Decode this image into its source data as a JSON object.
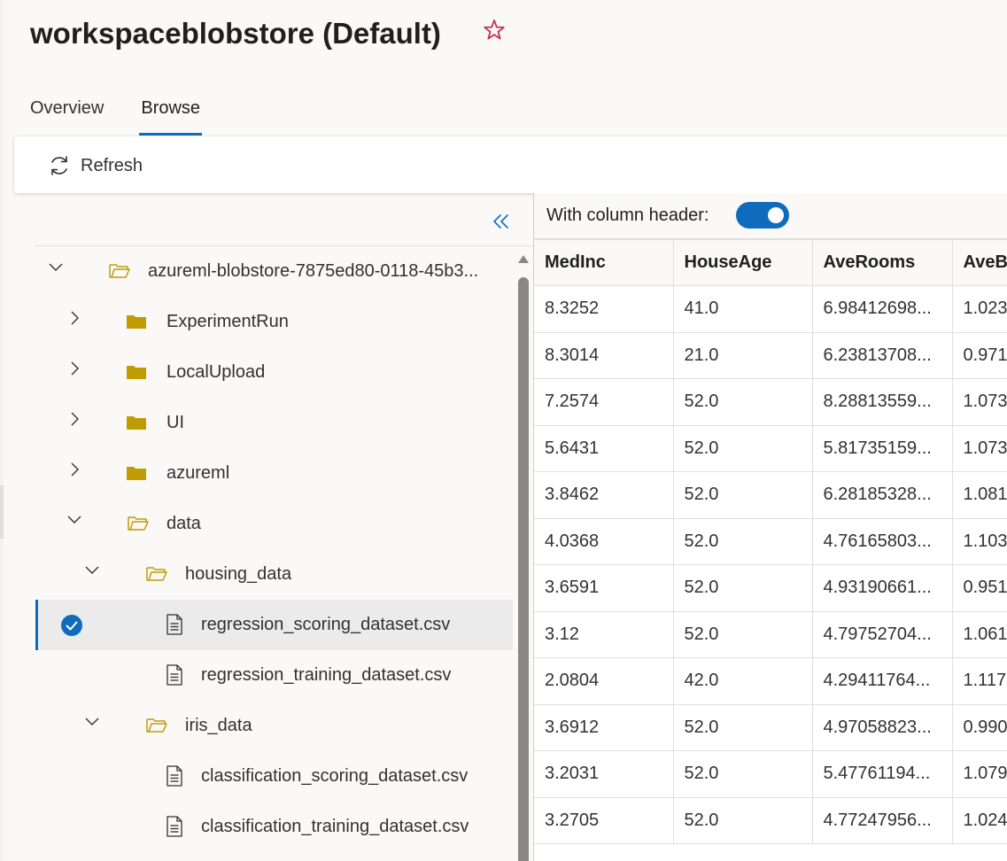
{
  "page": {
    "title": "workspaceblobstore (Default)"
  },
  "tabs": [
    {
      "label": "Overview",
      "active": false
    },
    {
      "label": "Browse",
      "active": true
    }
  ],
  "toolbar": {
    "refresh_label": "Refresh"
  },
  "tree": {
    "items": [
      {
        "label": "azureml-blobstore-7875ed80-0118-45b3...",
        "type": "folder-open",
        "expanded": true
      },
      {
        "label": "ExperimentRun",
        "type": "folder",
        "expanded": false
      },
      {
        "label": "LocalUpload",
        "type": "folder",
        "expanded": false
      },
      {
        "label": "UI",
        "type": "folder",
        "expanded": false
      },
      {
        "label": "azureml",
        "type": "folder",
        "expanded": false
      },
      {
        "label": "data",
        "type": "folder-open",
        "expanded": true
      },
      {
        "label": "housing_data",
        "type": "folder-open",
        "expanded": true
      },
      {
        "label": "regression_scoring_dataset.csv",
        "type": "file",
        "selected": true
      },
      {
        "label": "regression_training_dataset.csv",
        "type": "file"
      },
      {
        "label": "iris_data",
        "type": "folder-open",
        "expanded": true
      },
      {
        "label": "classification_scoring_dataset.csv",
        "type": "file"
      },
      {
        "label": "classification_training_dataset.csv",
        "type": "file"
      }
    ]
  },
  "preview": {
    "toggle_label": "With column header:",
    "toggle_on": true,
    "columns": [
      "MedInc",
      "HouseAge",
      "AveRooms",
      "AveBedrms"
    ],
    "rows": [
      [
        "8.3252",
        "41.0",
        "6.98412698...",
        "1.023"
      ],
      [
        "8.3014",
        "21.0",
        "6.23813708...",
        "0.971"
      ],
      [
        "7.2574",
        "52.0",
        "8.28813559...",
        "1.073"
      ],
      [
        "5.6431",
        "52.0",
        "5.81735159...",
        "1.073"
      ],
      [
        "3.8462",
        "52.0",
        "6.28185328...",
        "1.081"
      ],
      [
        "4.0368",
        "52.0",
        "4.76165803...",
        "1.103"
      ],
      [
        "3.6591",
        "52.0",
        "4.93190661...",
        "0.951"
      ],
      [
        "3.12",
        "52.0",
        "4.79752704...",
        "1.061"
      ],
      [
        "2.0804",
        "42.0",
        "4.29411764...",
        "1.117"
      ],
      [
        "3.6912",
        "52.0",
        "4.97058823...",
        "0.990"
      ],
      [
        "3.2031",
        "52.0",
        "5.47761194...",
        "1.079"
      ],
      [
        "3.2705",
        "52.0",
        "4.77247956...",
        "1.024"
      ]
    ]
  },
  "colors": {
    "accent": "#0f6cbd",
    "folder": "#c19c00",
    "favorite_star": "#c4314b"
  },
  "icons": {
    "favorite": "star-outline-icon",
    "refresh": "refresh-icon",
    "collapse": "double-chevron-left-icon",
    "selected": "checkmark-circle-icon"
  }
}
